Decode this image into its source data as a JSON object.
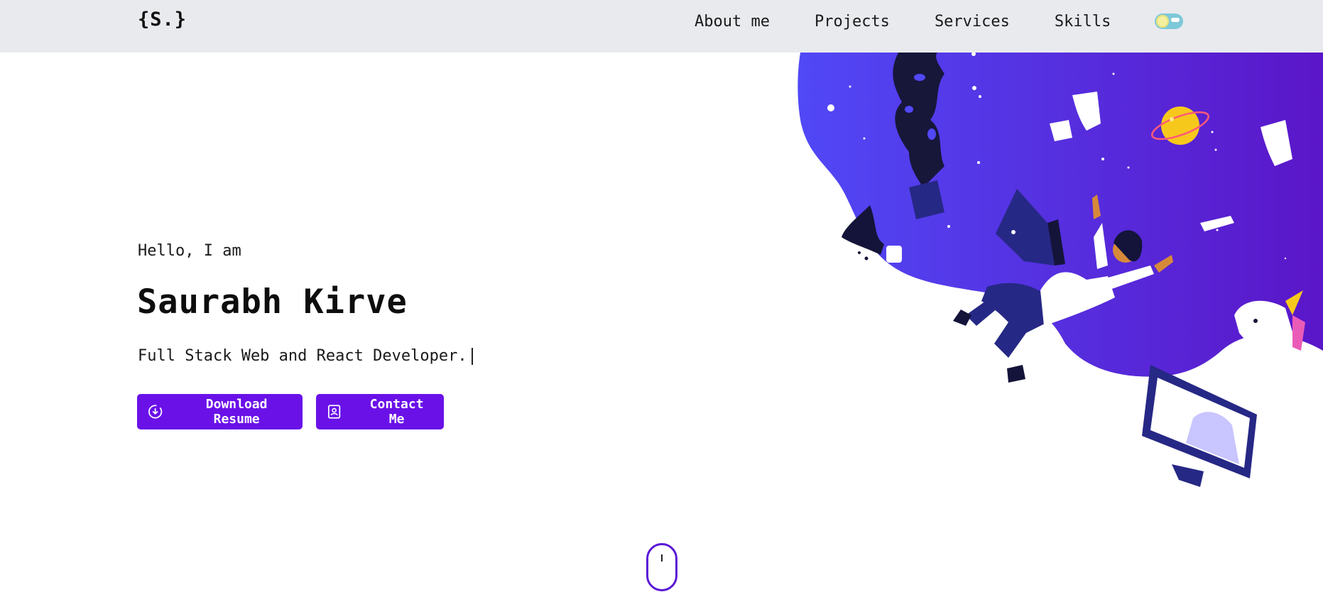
{
  "nav": {
    "logo": "{S.}",
    "links": [
      "About me",
      "Projects",
      "Services",
      "Skills"
    ],
    "theme_toggle": "light"
  },
  "hero": {
    "greeting": "Hello, I am",
    "name": "Saurabh Kirve",
    "role": "Full Stack Web and React Developer."
  },
  "buttons": {
    "download_label": "Download Resume",
    "download_icon": "download-circle-icon",
    "contact_label": "Contact Me",
    "contact_icon": "contact-card-icon"
  },
  "colors": {
    "accent": "#6a11e8",
    "navbar_bg": "#e9eaee",
    "blob_start": "#5148f6",
    "blob_end": "#5a16c8"
  },
  "scroll_indicator": "mouse-scroll-icon"
}
